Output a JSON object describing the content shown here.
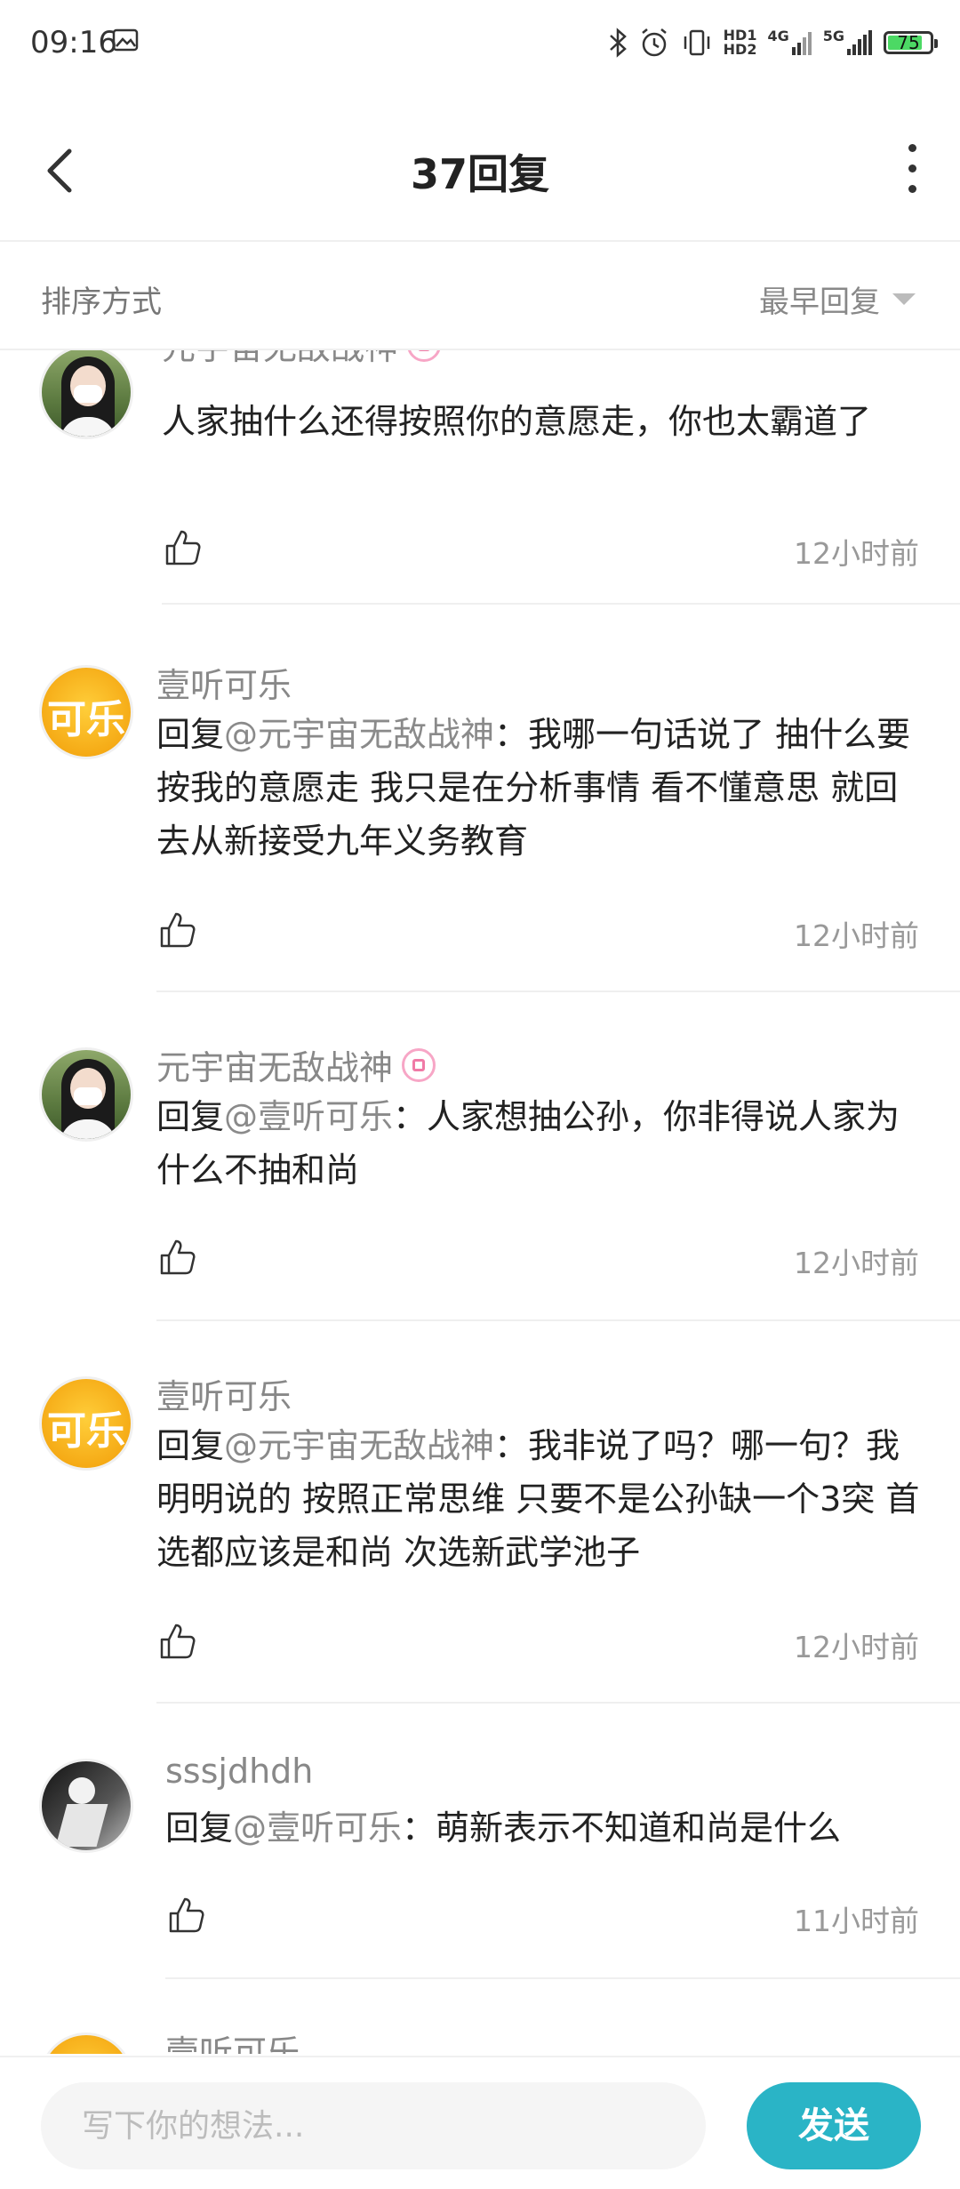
{
  "status_bar": {
    "time": "09:16",
    "hd1": "HD1",
    "hd2": "HD2",
    "net1": "4G",
    "net2": "5G",
    "battery": "75",
    "icons": [
      "image-icon",
      "bluetooth-icon",
      "alarm-icon",
      "vibrate-icon",
      "signal-icon",
      "battery-icon"
    ]
  },
  "header": {
    "title": "37回复",
    "icons": [
      "back-arrow-icon",
      "more-vertical-icon"
    ]
  },
  "sort": {
    "label": "排序方式",
    "value": "最早回复"
  },
  "comments": [
    {
      "user": "元宇宙无敌战神",
      "avatar": "girl-photo",
      "badge": true,
      "prefix": "",
      "mention": "",
      "text": "人家抽什么还得按照你的意愿走，你也太霸道了",
      "time": "12小时前"
    },
    {
      "user": "壹听可乐",
      "avatar": "cola-logo",
      "avatar_text": "可乐",
      "badge": false,
      "prefix": "回复",
      "mention": "@元宇宙无敌战神",
      "text": "：我哪一句话说了 抽什么要按我的意愿走 我只是在分析事情 看不懂意思 就回去从新接受九年义务教育",
      "time": "12小时前"
    },
    {
      "user": "元宇宙无敌战神",
      "avatar": "girl-photo",
      "badge": true,
      "prefix": "回复",
      "mention": "@壹听可乐",
      "text": "：人家想抽公孙，你非得说人家为什么不抽和尚",
      "time": "12小时前"
    },
    {
      "user": "壹听可乐",
      "avatar": "cola-logo",
      "avatar_text": "可乐",
      "badge": false,
      "prefix": "回复",
      "mention": "@元宇宙无敌战神",
      "text": "：我非说了吗？哪一句？我明明说的 按照正常思维 只要不是公孙缺一个3突 首选都应该是和尚 次选新武学池子",
      "time": "12小时前"
    },
    {
      "user": "sssjdhdh",
      "avatar": "dark-photo",
      "badge": false,
      "prefix": "回复",
      "mention": "@壹听可乐",
      "text": "：萌新表示不知道和尚是什么",
      "time": "11小时前"
    },
    {
      "user": "壹听可乐",
      "avatar": "cola-logo",
      "avatar_text": "可乐",
      "badge": false
    }
  ],
  "input": {
    "placeholder": "写下你的想法...",
    "send_label": "发送"
  },
  "colors": {
    "accent": "#2ab4c6",
    "mention": "#8a8a8a",
    "badge": "#f07aa6"
  }
}
